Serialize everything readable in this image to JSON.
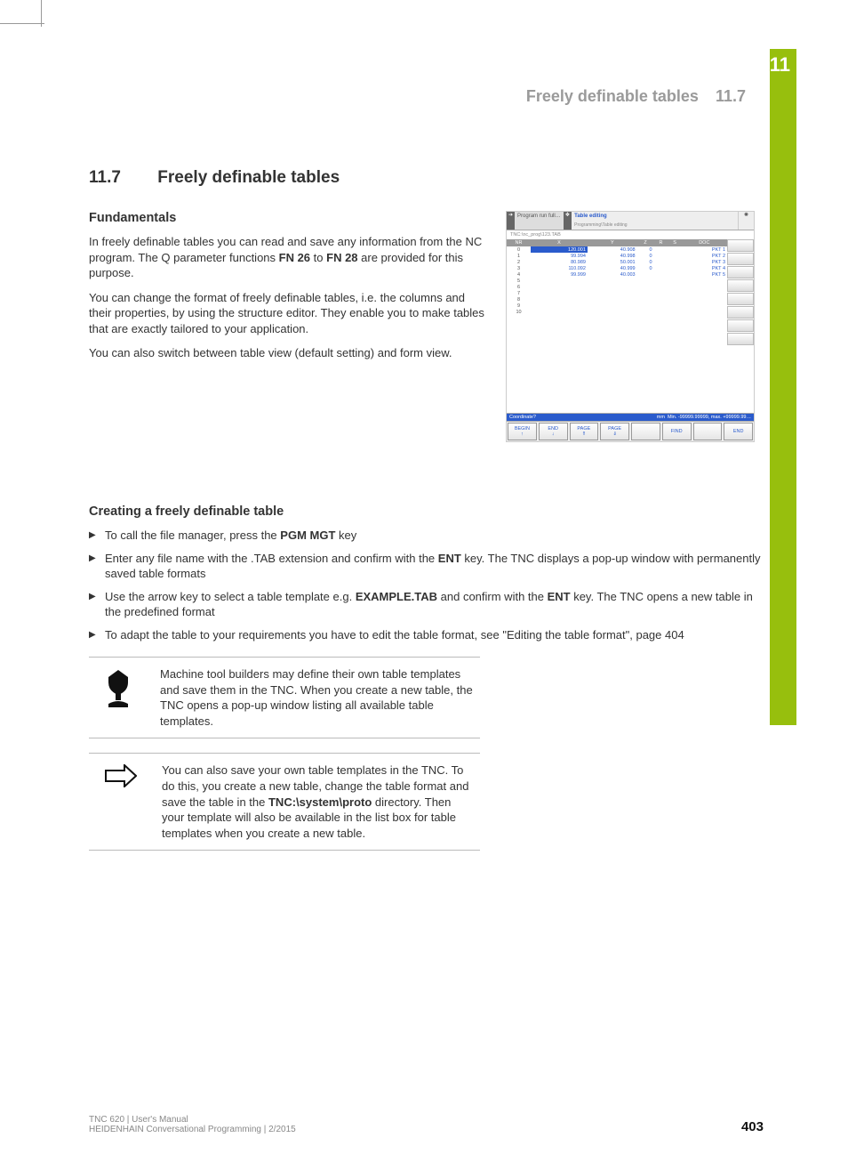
{
  "chapter": "11",
  "running_head": {
    "title": "Freely definable tables",
    "num": "11.7"
  },
  "h1": {
    "secnum": "11.7",
    "title": "Freely definable tables"
  },
  "sec1": {
    "heading": "Fundamentals",
    "p1a": "In freely definable tables you can read and save any information from the NC program. The Q parameter functions ",
    "fn26": "FN 26",
    "p1b": " to ",
    "fn28": "FN 28",
    "p1c": " are provided for this purpose.",
    "p2": "You can change the format of freely definable tables, i.e. the columns and their properties, by using the structure editor. They enable you to make tables that are exactly tailored to your application.",
    "p3": "You can also switch between table view (default setting) and form view."
  },
  "sec2": {
    "heading": "Creating a freely definable table",
    "li1a": "To call the file manager, press the ",
    "li1b": "PGM MGT",
    "li1c": " key",
    "li2a": "Enter any file name with the .TAB extension and confirm with the ",
    "li2b": "ENT",
    "li2c": " key. The TNC displays a pop-up window with permanently saved table formats",
    "li3a": "Use the arrow key to select a table template e.g. ",
    "li3b": "EXAMPLE.TAB",
    "li3c": " and confirm with the ",
    "li3d": "ENT",
    "li3e": " key. The TNC opens a new table in the predefined format",
    "li4": "To adapt the table to your requirements you have to edit the table format, see \"Editing the table format\", page 404"
  },
  "note1": "Machine tool builders may define their own table templates and save them in the TNC. When you create a new table, the TNC opens a pop-up window listing all available table templates.",
  "note2a": "You can also save your own table templates in the TNC. To do this, you create a new table, change the table format and save the table in the ",
  "note2b": "TNC:\\system\\proto",
  "note2c": " directory. Then your template will also be available in the list box for table templates when you create a new table.",
  "screenshot": {
    "mode": "Program run full…",
    "title": "Table editing",
    "subtitle": "Programming\\Table editing",
    "path": "TNC:\\nc_prog\\123.TAB",
    "headers": [
      "NR",
      "X",
      "Y",
      "Z",
      "R",
      "S",
      "DOC"
    ],
    "rows": [
      [
        "0",
        "120.001",
        "40.908",
        "0",
        "",
        "",
        "PKT 1"
      ],
      [
        "1",
        "99.994",
        "40.998",
        "0",
        "",
        "",
        "PKT 2"
      ],
      [
        "2",
        "80.989",
        "50.001",
        "0",
        "",
        "",
        "PKT 3"
      ],
      [
        "3",
        "110.092",
        "40.999",
        "0",
        "",
        "",
        "PKT 4"
      ],
      [
        "4",
        "99.999",
        "40.003",
        "",
        "",
        "",
        "PKT 5"
      ],
      [
        "5",
        "",
        "",
        "",
        "",
        "",
        ""
      ],
      [
        "6",
        "",
        "",
        "",
        "",
        "",
        ""
      ],
      [
        "7",
        "",
        "",
        "",
        "",
        "",
        ""
      ],
      [
        "8",
        "",
        "",
        "",
        "",
        "",
        ""
      ],
      [
        "9",
        "",
        "",
        "",
        "",
        "",
        ""
      ],
      [
        "10",
        "",
        "",
        "",
        "",
        "",
        ""
      ]
    ],
    "status_label": "Coordinate?",
    "status_mm": "mm",
    "status_min": "Min. -99999.99999, max. +99999.99…",
    "softkeys": [
      "BEGIN",
      "END",
      "PAGE",
      "PAGE",
      "",
      "FIND",
      "",
      "END"
    ]
  },
  "footer": {
    "line1": "TNC 620 | User's Manual",
    "line2": "HEIDENHAIN Conversational Programming | 2/2015",
    "page": "403"
  }
}
